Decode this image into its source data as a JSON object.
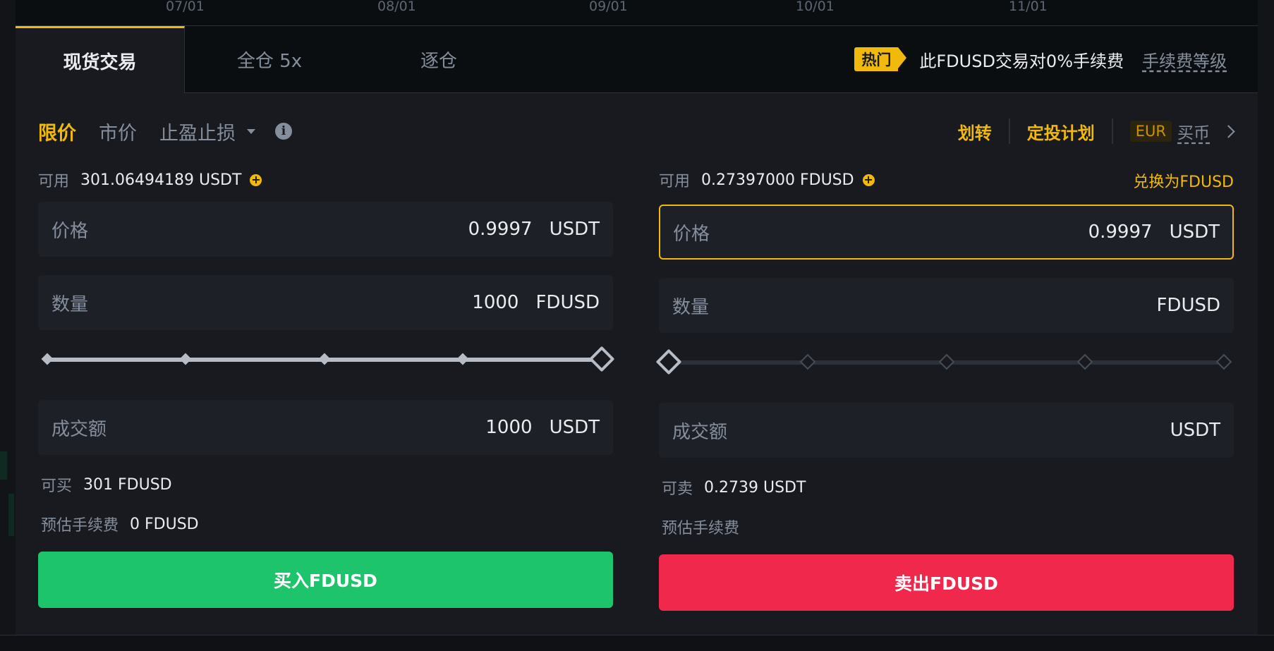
{
  "timeline": {
    "ticks": [
      "07/01",
      "08/01",
      "09/01",
      "10/01",
      "11/01"
    ]
  },
  "tabs": {
    "spot": "现货交易",
    "cross": "全仓 5x",
    "isolated": "逐仓"
  },
  "promo": {
    "badge": "热门",
    "text": "此FDUSD交易对0%手续费",
    "fee_level": "手续费等级"
  },
  "order_types": {
    "limit": "限价",
    "market": "市价",
    "stop": "止盈止损",
    "active": "限价"
  },
  "top_links": {
    "transfer": "划转",
    "auto_invest": "定投计划",
    "currency": "EUR",
    "buy_crypto": "买币"
  },
  "buy": {
    "avail_label": "可用",
    "avail_value": "301.06494189 USDT",
    "price_label": "价格",
    "price_value": "0.9997",
    "price_unit": "USDT",
    "qty_label": "数量",
    "qty_value": "1000",
    "qty_unit": "FDUSD",
    "slider_percent": 100,
    "total_label": "成交额",
    "total_value": "1000",
    "total_unit": "USDT",
    "max_label": "可买",
    "max_value": "301 FDUSD",
    "fee_label": "预估手续费",
    "fee_value": "0 FDUSD",
    "button": "买入FDUSD"
  },
  "sell": {
    "avail_label": "可用",
    "avail_value": "0.27397000 FDUSD",
    "convert": "兑换为FDUSD",
    "price_label": "价格",
    "price_value": "0.9997",
    "price_unit": "USDT",
    "qty_label": "数量",
    "qty_value": "",
    "qty_unit": "FDUSD",
    "slider_percent": 0,
    "total_label": "成交额",
    "total_value": "",
    "total_unit": "USDT",
    "max_label": "可卖",
    "max_value": "0.2739 USDT",
    "fee_label": "预估手续费",
    "button": "卖出FDUSD"
  },
  "colors": {
    "accent": "#f0b90b",
    "buy": "#1dc46c",
    "sell": "#f0294c",
    "background": "#181a20"
  }
}
